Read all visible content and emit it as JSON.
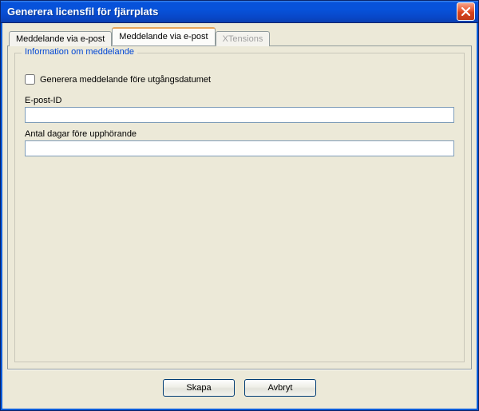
{
  "window": {
    "title": "Generera licensfil för fjärrplats"
  },
  "tabs": {
    "t1": {
      "label": "Meddelande via e-post"
    },
    "t2": {
      "label": "Meddelande via e-post"
    },
    "t3": {
      "label": "XTensions"
    }
  },
  "group": {
    "legend": "Information om meddelande",
    "checkbox_label": "Generera meddelande före utgångsdatumet",
    "email_label": "E-post-ID",
    "email_value": "",
    "days_label": "Antal dagar före upphörande",
    "days_value": ""
  },
  "buttons": {
    "ok": "Skapa",
    "cancel": "Avbryt"
  }
}
